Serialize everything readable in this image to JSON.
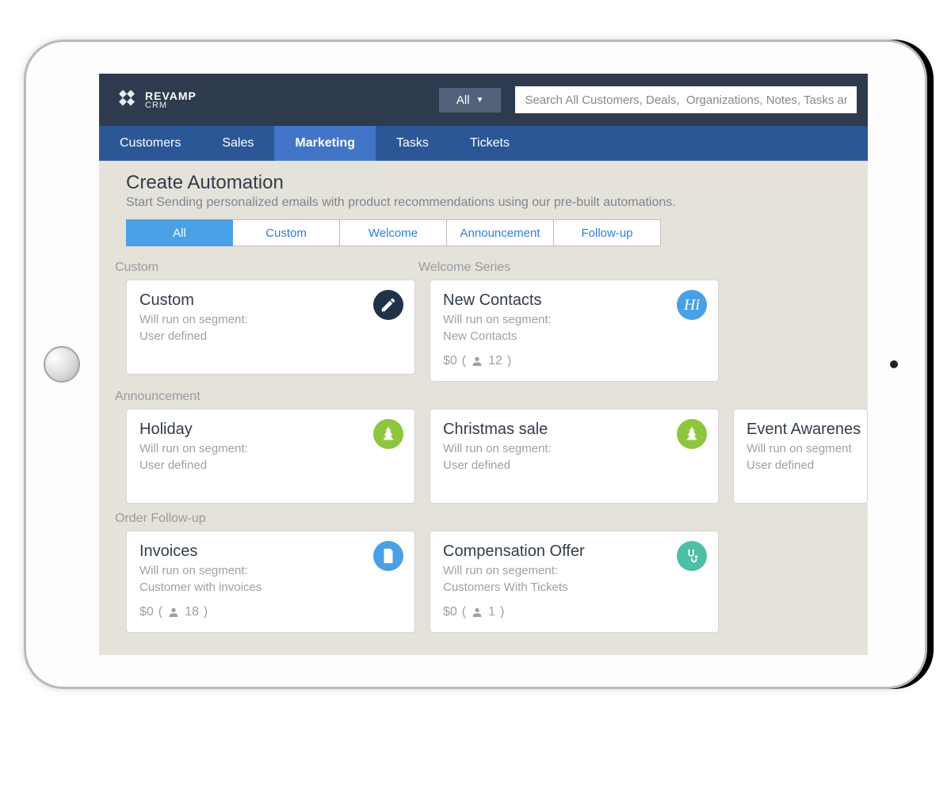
{
  "brand": {
    "line1": "REVAMP",
    "line2": "CRM"
  },
  "topbar": {
    "filter_label": "All",
    "search_placeholder": "Search All Customers, Deals,  Organizations, Notes, Tasks and"
  },
  "nav": {
    "items": [
      "Customers",
      "Sales",
      "Marketing",
      "Tasks",
      "Tickets"
    ],
    "active_index": 2
  },
  "page": {
    "title": "Create Automation",
    "subtitle": "Start Sending personalized emails with product recommendations using our pre-built automations."
  },
  "filter_tabs": {
    "items": [
      "All",
      "Custom",
      "Welcome",
      "Announcement",
      "Follow-up"
    ],
    "selected_index": 0
  },
  "sections": {
    "custom_label": "Custom",
    "welcome_label": "Welcome Series",
    "announcement_label": "Announcement",
    "followup_label": "Order Follow-up"
  },
  "cards": {
    "custom": {
      "title": "Custom",
      "seg_label": "Will run on segment:",
      "seg_value": "User defined"
    },
    "newcontacts": {
      "title": "New Contacts",
      "seg_label": "Will run on segment:",
      "seg_value": "New Contacts",
      "amount": "$0",
      "count": "12",
      "hi": "Hi"
    },
    "holiday": {
      "title": "Holiday",
      "seg_label": "Will run on segment:",
      "seg_value": "User defined"
    },
    "christmas": {
      "title": "Christmas sale",
      "seg_label": "Will run on segment:",
      "seg_value": "User defined"
    },
    "event": {
      "title": "Event Awarenes",
      "seg_label": "Will run on segment",
      "seg_value": "User defined"
    },
    "invoices": {
      "title": "Invoices",
      "seg_label": "Will run on segment:",
      "seg_value": "Customer with invoices",
      "amount": "$0",
      "count": "18"
    },
    "compensation": {
      "title": "Compensation Offer",
      "seg_label": "Will run on segement:",
      "seg_value": "Customers With Tickets",
      "amount": "$0",
      "count": "1"
    }
  }
}
